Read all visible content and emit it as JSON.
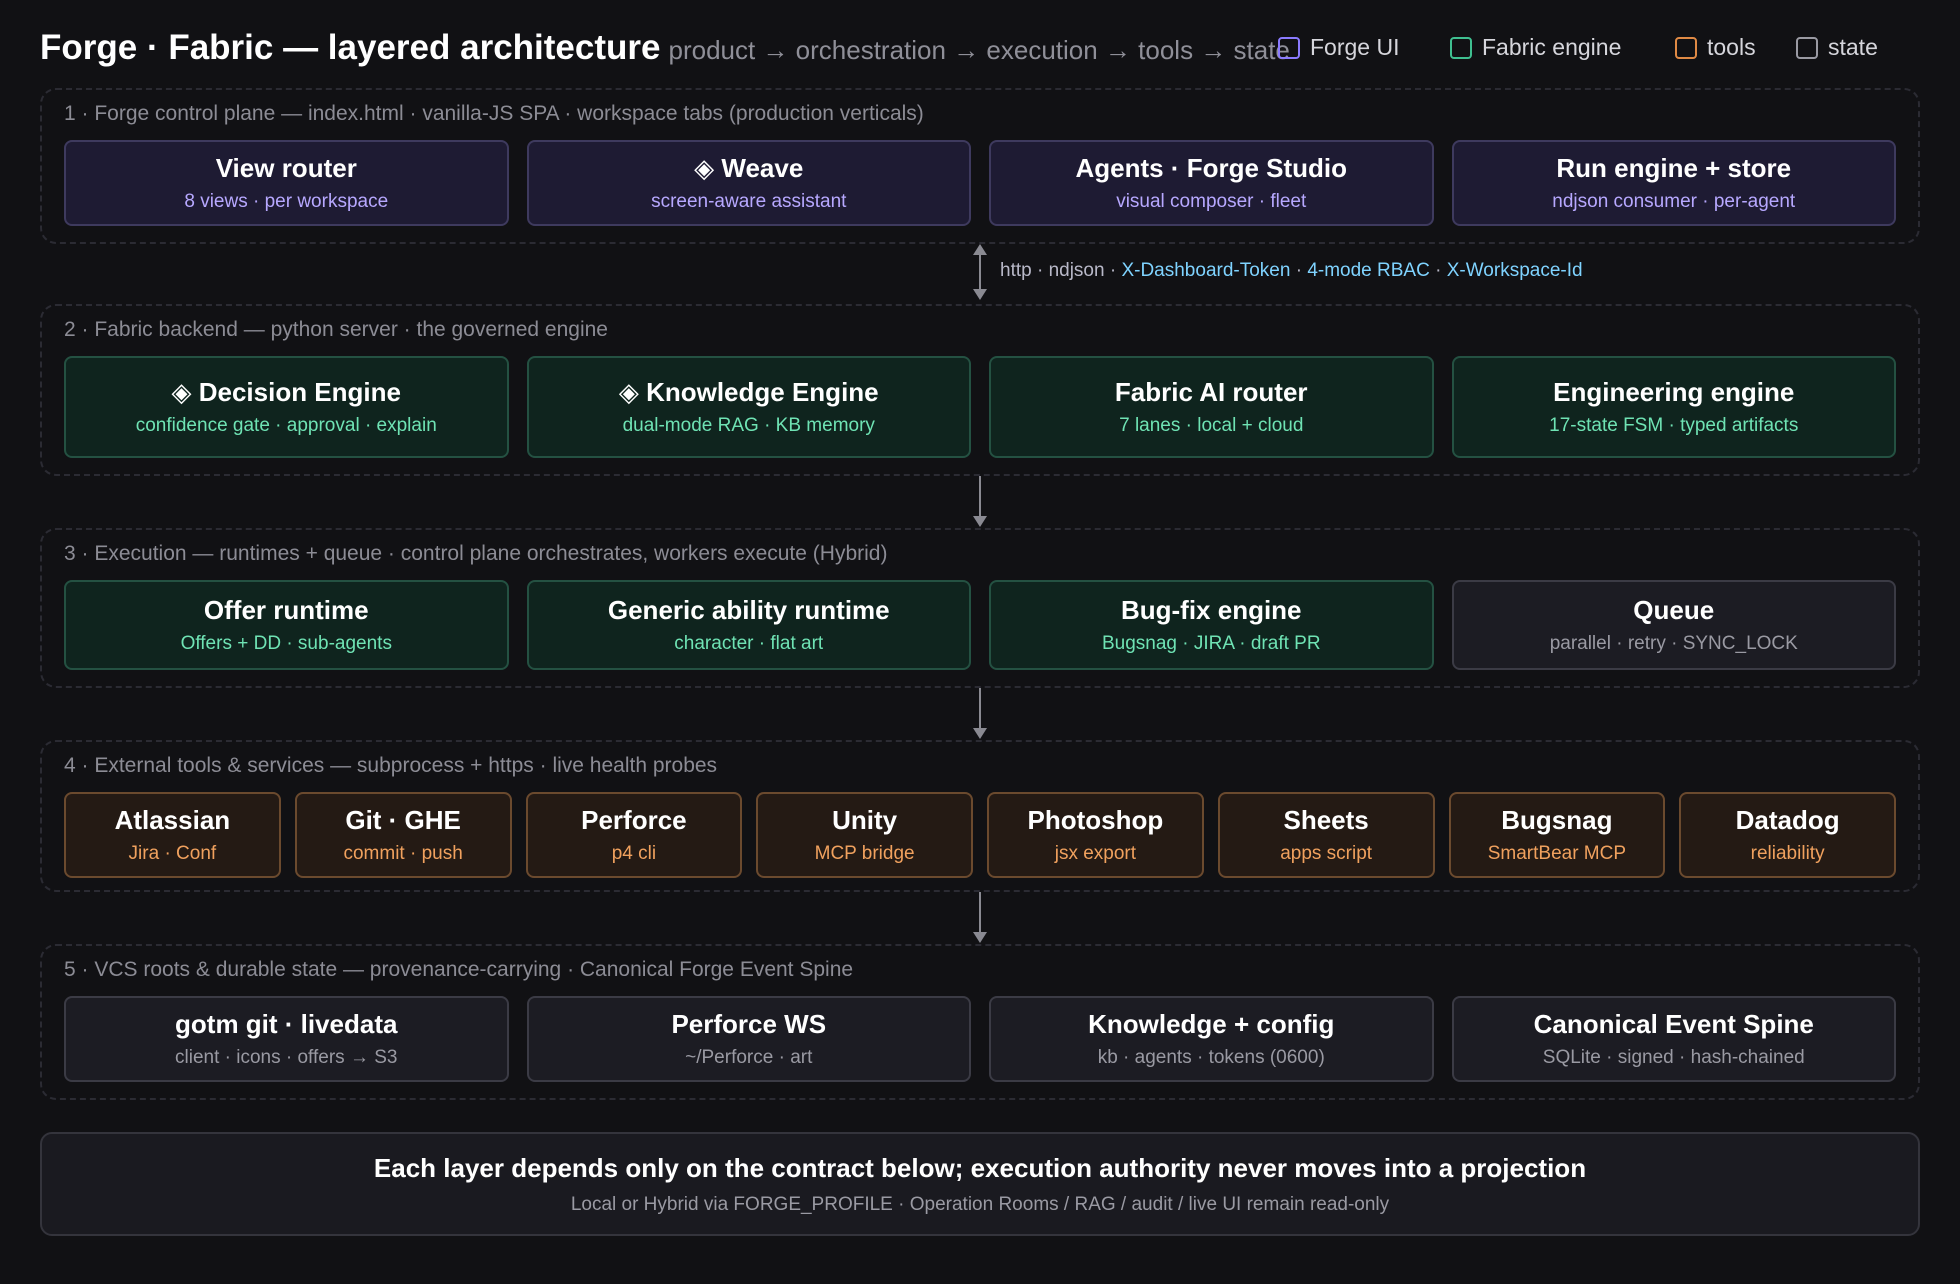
{
  "header": {
    "title": "Forge · Fabric — layered architecture",
    "subtitle": "product → orchestration → execution → tools → state"
  },
  "legend": [
    {
      "label": "Forge UI",
      "color": "#8b7bff"
    },
    {
      "label": "Fabric engine",
      "color": "#3fbf90"
    },
    {
      "label": "tools",
      "color": "#e08a45"
    },
    {
      "label": "state",
      "color": "#9a9aa3"
    }
  ],
  "layers": [
    {
      "label": "1 · Forge control plane — index.html · vanilla-JS SPA · workspace tabs (production verticals)",
      "boxes": [
        {
          "title": "View router",
          "sub": "8 views · per workspace"
        },
        {
          "title": "◈ Weave",
          "sub": "screen-aware assistant"
        },
        {
          "title": "Agents · Forge Studio",
          "sub": "visual composer · fleet"
        },
        {
          "title": "Run engine + store",
          "sub": "ndjson consumer · per-agent"
        }
      ]
    },
    {
      "label": "2 · Fabric backend — python server · the governed engine",
      "boxes": [
        {
          "title": "◈ Decision Engine",
          "sub": "confidence gate · approval · explain"
        },
        {
          "title": "◈ Knowledge Engine",
          "sub": "dual-mode RAG · KB memory"
        },
        {
          "title": "Fabric AI router",
          "sub": "7 lanes · local + cloud"
        },
        {
          "title": "Engineering engine",
          "sub": "17-state FSM · typed artifacts"
        }
      ]
    },
    {
      "label": "3 · Execution — runtimes + queue · control plane orchestrates, workers execute (Hybrid)",
      "boxes": [
        {
          "title": "Offer runtime",
          "sub": "Offers + DD · sub-agents"
        },
        {
          "title": "Generic ability runtime",
          "sub": "character · flat art"
        },
        {
          "title": "Bug-fix engine",
          "sub": "Bugsnag · JIRA · draft PR"
        },
        {
          "title": "Queue",
          "sub": "parallel · retry · SYNC_LOCK"
        }
      ]
    },
    {
      "label": "4 · External tools & services — subprocess + https · live health probes",
      "boxes": [
        {
          "title": "Atlassian",
          "sub": "Jira · Conf"
        },
        {
          "title": "Git · GHE",
          "sub": "commit · push"
        },
        {
          "title": "Perforce",
          "sub": "p4 cli"
        },
        {
          "title": "Unity",
          "sub": "MCP bridge"
        },
        {
          "title": "Photoshop",
          "sub": "jsx export"
        },
        {
          "title": "Sheets",
          "sub": "apps script"
        },
        {
          "title": "Bugsnag",
          "sub": "SmartBear MCP"
        },
        {
          "title": "Datadog",
          "sub": "reliability"
        }
      ]
    },
    {
      "label": "5 · VCS roots & durable state — provenance-carrying · Canonical Forge Event Spine",
      "boxes": [
        {
          "title": "gotm git · livedata",
          "sub": "client · icons · offers → S3"
        },
        {
          "title": "Perforce WS",
          "sub": "~/Perforce · art"
        },
        {
          "title": "Knowledge + config",
          "sub": "kb · agents · tokens (0600)"
        },
        {
          "title": "Canonical Event Spine",
          "sub": "SQLite · signed · hash-chained"
        }
      ]
    }
  ],
  "protocol": {
    "plain": "http · ndjson · ",
    "parts": [
      "X-Dashboard-Token",
      "4-mode RBAC",
      "X-Workspace-Id"
    ],
    "sep": " · "
  },
  "footer": {
    "title": "Each layer depends only on the contract below; execution authority never moves into a projection",
    "sub": "Local or Hybrid via FORGE_PROFILE · Operation Rooms / RAG / audit / live UI remain read-only"
  }
}
